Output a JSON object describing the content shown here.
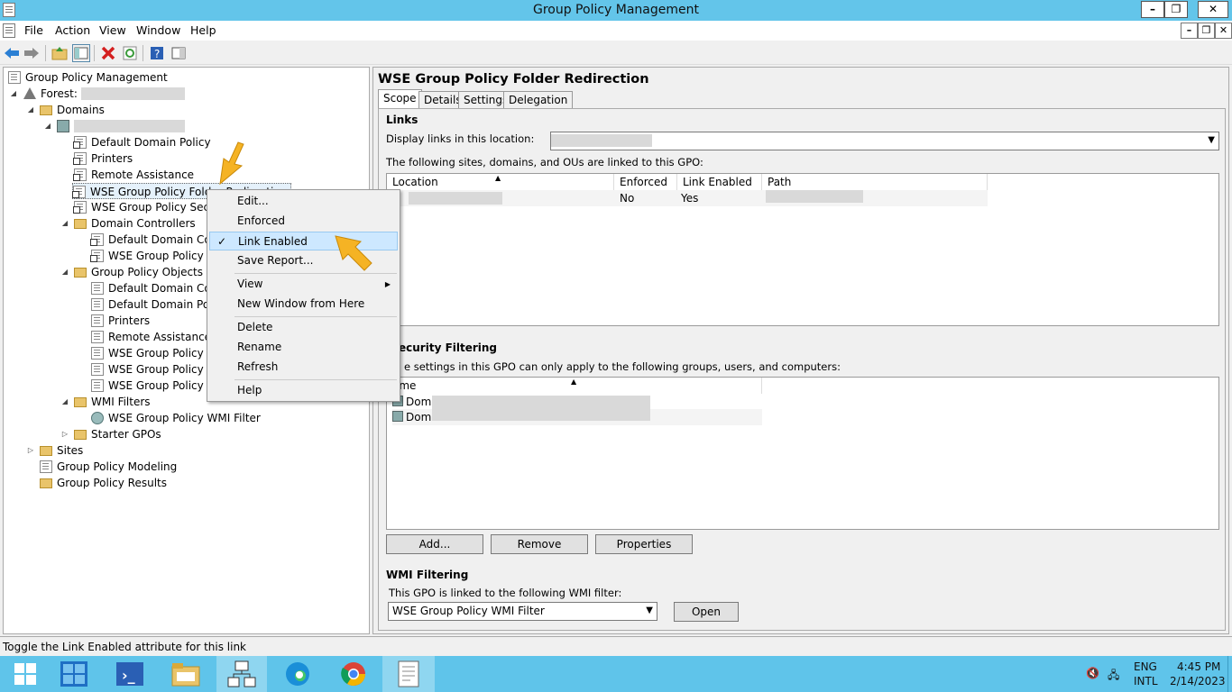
{
  "window": {
    "title": "Group Policy Management"
  },
  "menubar": {
    "items": [
      "File",
      "Action",
      "View",
      "Window",
      "Help"
    ]
  },
  "window_buttons": {
    "minimize": "–",
    "restore": "❐",
    "close": "✕"
  },
  "tree": {
    "root": "Group Policy Management",
    "forest_label": "Forest:",
    "domains": "Domains",
    "items": {
      "default_domain_policy": "Default Domain Policy",
      "printers": "Printers",
      "remote_assistance": "Remote Assistance",
      "wse_folder_redirection": "WSE Group Policy Folder Redirection",
      "wse_security": "WSE Group Policy Security",
      "domain_controllers": "Domain Controllers",
      "dc_default_policy": "Default Domain Controllers Policy",
      "dc_wse_policy": "WSE Group Policy Password Policy",
      "gpo_folder": "Group Policy Objects",
      "gpo_default_dc": "Default Domain Controllers Policy",
      "gpo_default_domain": "Default Domain Policy",
      "gpo_printers": "Printers",
      "gpo_remote": "Remote Assistance",
      "gpo_wse_folder": "WSE Group Policy Folder Redirection",
      "gpo_wse_password": "WSE Group Policy Password Policy",
      "gpo_wse_security": "WSE Group Policy Security",
      "wmi_filters": "WMI Filters",
      "wmi_filter_item": "WSE Group Policy WMI Filter",
      "starter_gpos": "Starter GPOs",
      "sites": "Sites",
      "modeling": "Group Policy Modeling",
      "results": "Group Policy Results"
    }
  },
  "context_menu": {
    "edit": "Edit...",
    "enforced": "Enforced",
    "link_enabled": "Link Enabled",
    "link_enabled_checked": "✓",
    "save_report": "Save Report...",
    "view": "View",
    "new_window": "New Window from Here",
    "delete": "Delete",
    "rename": "Rename",
    "refresh": "Refresh",
    "help": "Help"
  },
  "details": {
    "title": "WSE Group Policy Folder Redirection",
    "tabs": [
      "Scope",
      "Details",
      "Settings",
      "Delegation"
    ],
    "links_heading": "Links",
    "display_links_label": "Display links in this location:",
    "linked_text": "The following sites, domains, and OUs are linked to this GPO:",
    "links_columns": [
      "Location",
      "Enforced",
      "Link Enabled",
      "Path"
    ],
    "links_rows": [
      {
        "location": "",
        "enforced": "No",
        "link_enabled": "Yes",
        "path": ""
      }
    ],
    "security_heading": "ecurity Filtering",
    "security_text": "e settings in this GPO can only apply to the following groups, users, and computers:",
    "security_column": "ame",
    "security_rows": [
      "Doma",
      "Doma"
    ],
    "buttons": {
      "add": "Add...",
      "remove": "Remove",
      "properties": "Properties"
    },
    "wmi_heading": "WMI Filtering",
    "wmi_text": "This GPO is linked to the following WMI filter:",
    "wmi_value": "WSE Group Policy WMI Filter",
    "open_button": "Open"
  },
  "status": {
    "text": "Toggle the Link Enabled attribute for this link"
  },
  "tray": {
    "lang1": "ENG",
    "lang2": "INTL",
    "time": "4:45 PM",
    "date": "2/14/2023"
  },
  "colors": {
    "titlebar": "#63c5ea",
    "taskbar": "#5fc4ea",
    "highlight": "#cde8ff",
    "arrow": "#f5b324"
  }
}
